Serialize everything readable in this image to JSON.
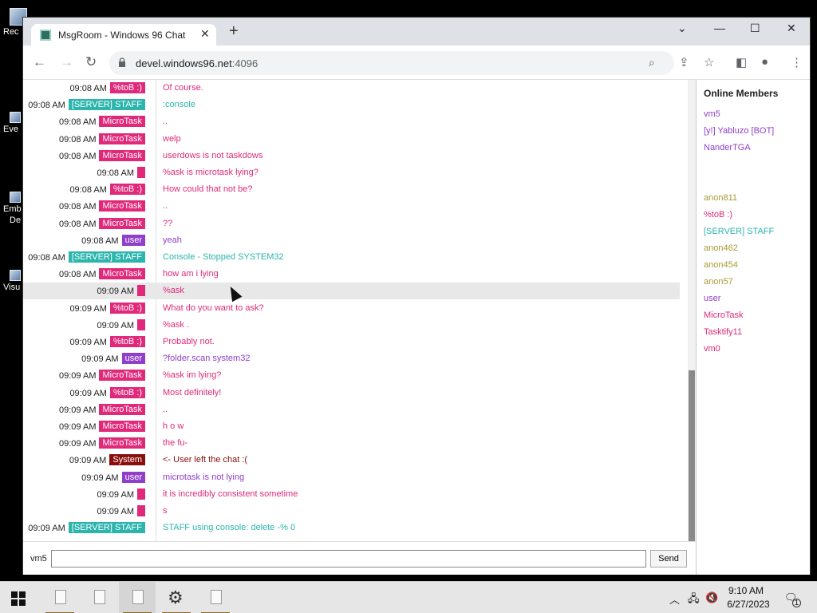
{
  "desktop": {
    "icons": [
      {
        "label": "Rec"
      },
      {
        "label": "Eve"
      },
      {
        "label": "Emb"
      },
      {
        "label": "De"
      },
      {
        "label": "Visu"
      }
    ]
  },
  "browser": {
    "tab_title": "MsgRoom - Windows 96 Chat",
    "tab_close": "✕",
    "new_tab": "+",
    "url_host": "devel.windows96.net",
    "url_port": ":4096"
  },
  "chat": {
    "messages": [
      {
        "time": "09:08 AM",
        "nick": "%toB :)",
        "nick_color": "#e0297a",
        "text": "Of course.",
        "text_color": "#e0297a"
      },
      {
        "time": "09:08 AM",
        "nick": "[SERVER] STAFF",
        "nick_color": "#2bb5ad",
        "text": ":console",
        "text_color": "#2bb5ad"
      },
      {
        "time": "09:08 AM",
        "nick": "MicroTask",
        "nick_color": "#e0297a",
        "text": "..",
        "text_color": "#e0297a"
      },
      {
        "time": "09:08 AM",
        "nick": "MicroTask",
        "nick_color": "#e0297a",
        "text": "welp",
        "text_color": "#e0297a"
      },
      {
        "time": "09:08 AM",
        "nick": "MicroTask",
        "nick_color": "#e0297a",
        "text": "userdows is not taskdows",
        "text_color": "#e0297a"
      },
      {
        "time": "09:08 AM",
        "nick": "",
        "nick_color": "#e0297a",
        "text": "%ask is microtask lying?",
        "text_color": "#e0297a"
      },
      {
        "time": "09:08 AM",
        "nick": "%toB :)",
        "nick_color": "#e0297a",
        "text": "How could that not be?",
        "text_color": "#e0297a"
      },
      {
        "time": "09:08 AM",
        "nick": "MicroTask",
        "nick_color": "#e0297a",
        "text": "..",
        "text_color": "#e0297a"
      },
      {
        "time": "09:08 AM",
        "nick": "MicroTask",
        "nick_color": "#e0297a",
        "text": "??",
        "text_color": "#e0297a"
      },
      {
        "time": "09:08 AM",
        "nick": "user",
        "nick_color": "#8f3fc9",
        "text": "yeah",
        "text_color": "#8f3fc9"
      },
      {
        "time": "09:08 AM",
        "nick": "[SERVER] STAFF",
        "nick_color": "#2bb5ad",
        "text": "Console - Stopped SYSTEM32",
        "text_color": "#2bb5ad"
      },
      {
        "time": "09:08 AM",
        "nick": "MicroTask",
        "nick_color": "#e0297a",
        "text": "how am i lying",
        "text_color": "#e0297a"
      },
      {
        "time": "09:09 AM",
        "nick": "",
        "nick_color": "#e0297a",
        "text": "%ask",
        "text_color": "#e0297a",
        "highlight": true
      },
      {
        "time": "09:09 AM",
        "nick": "%toB :)",
        "nick_color": "#e0297a",
        "text": "What do you want to ask?",
        "text_color": "#e0297a"
      },
      {
        "time": "09:09 AM",
        "nick": "",
        "nick_color": "#e0297a",
        "text": "%ask .",
        "text_color": "#e0297a"
      },
      {
        "time": "09:09 AM",
        "nick": "%toB :)",
        "nick_color": "#e0297a",
        "text": "Probably not.",
        "text_color": "#e0297a"
      },
      {
        "time": "09:09 AM",
        "nick": "user",
        "nick_color": "#8f3fc9",
        "text": "?folder.scan system32",
        "text_color": "#8f3fc9"
      },
      {
        "time": "09:09 AM",
        "nick": "MicroTask",
        "nick_color": "#e0297a",
        "text": "%ask im lying?",
        "text_color": "#e0297a"
      },
      {
        "time": "09:09 AM",
        "nick": "%toB :)",
        "nick_color": "#e0297a",
        "text": "Most definitely!",
        "text_color": "#e0297a"
      },
      {
        "time": "09:09 AM",
        "nick": "MicroTask",
        "nick_color": "#e0297a",
        "text": "..",
        "text_color": "#e0297a"
      },
      {
        "time": "09:09 AM",
        "nick": "MicroTask",
        "nick_color": "#e0297a",
        "text": "h o w",
        "text_color": "#e0297a"
      },
      {
        "time": "09:09 AM",
        "nick": "MicroTask",
        "nick_color": "#e0297a",
        "text": "the fu-",
        "text_color": "#e0297a"
      },
      {
        "time": "09:09 AM",
        "nick": "System",
        "nick_color": "#8b0e0e",
        "text": "<- User   left the chat :(",
        "text_color": "#8b0e0e"
      },
      {
        "time": "09:09 AM",
        "nick": "user",
        "nick_color": "#8f3fc9",
        "text": "microtask is not lying",
        "text_color": "#8f3fc9"
      },
      {
        "time": "09:09 AM",
        "nick": "",
        "nick_color": "#e0297a",
        "text": "it is incredibly consistent sometime",
        "text_color": "#e0297a"
      },
      {
        "time": "09:09 AM",
        "nick": "",
        "nick_color": "#e0297a",
        "text": "s",
        "text_color": "#e0297a"
      },
      {
        "time": "09:09 AM",
        "nick": "[SERVER] STAFF",
        "nick_color": "#2bb5ad",
        "text": "STAFF using console: delete -% 0",
        "text_color": "#2bb5ad"
      }
    ],
    "input_nick": "vm5",
    "input_value": "",
    "send_label": "Send"
  },
  "members": {
    "title": "Online Members",
    "list": [
      {
        "name": "vm5",
        "color": "#8f3fc9",
        "gap": false
      },
      {
        "name": "[y!] Yabluzo [BOT]",
        "color": "#8f3fc9",
        "gap": false
      },
      {
        "name": "NanderTGA",
        "color": "#8f3fc9",
        "gap": false
      },
      {
        "name": "anon811",
        "color": "#a89a36",
        "gap": true
      },
      {
        "name": "%toB :)",
        "color": "#e0297a",
        "gap": false
      },
      {
        "name": "[SERVER] STAFF",
        "color": "#2bb5ad",
        "gap": false
      },
      {
        "name": "anon462",
        "color": "#a89a36",
        "gap": false
      },
      {
        "name": "anon454",
        "color": "#a89a36",
        "gap": false
      },
      {
        "name": "anon57",
        "color": "#a89a36",
        "gap": false
      },
      {
        "name": "user",
        "color": "#8f3fc9",
        "gap": false
      },
      {
        "name": "MicroTask",
        "color": "#e0297a",
        "gap": false
      },
      {
        "name": "Tasktify11",
        "color": "#e0297a",
        "gap": false
      },
      {
        "name": "vm0",
        "color": "#e0297a",
        "gap": false
      }
    ]
  },
  "taskbar": {
    "time": "9:10 AM",
    "date": "6/27/2023",
    "notification_count": "1"
  }
}
